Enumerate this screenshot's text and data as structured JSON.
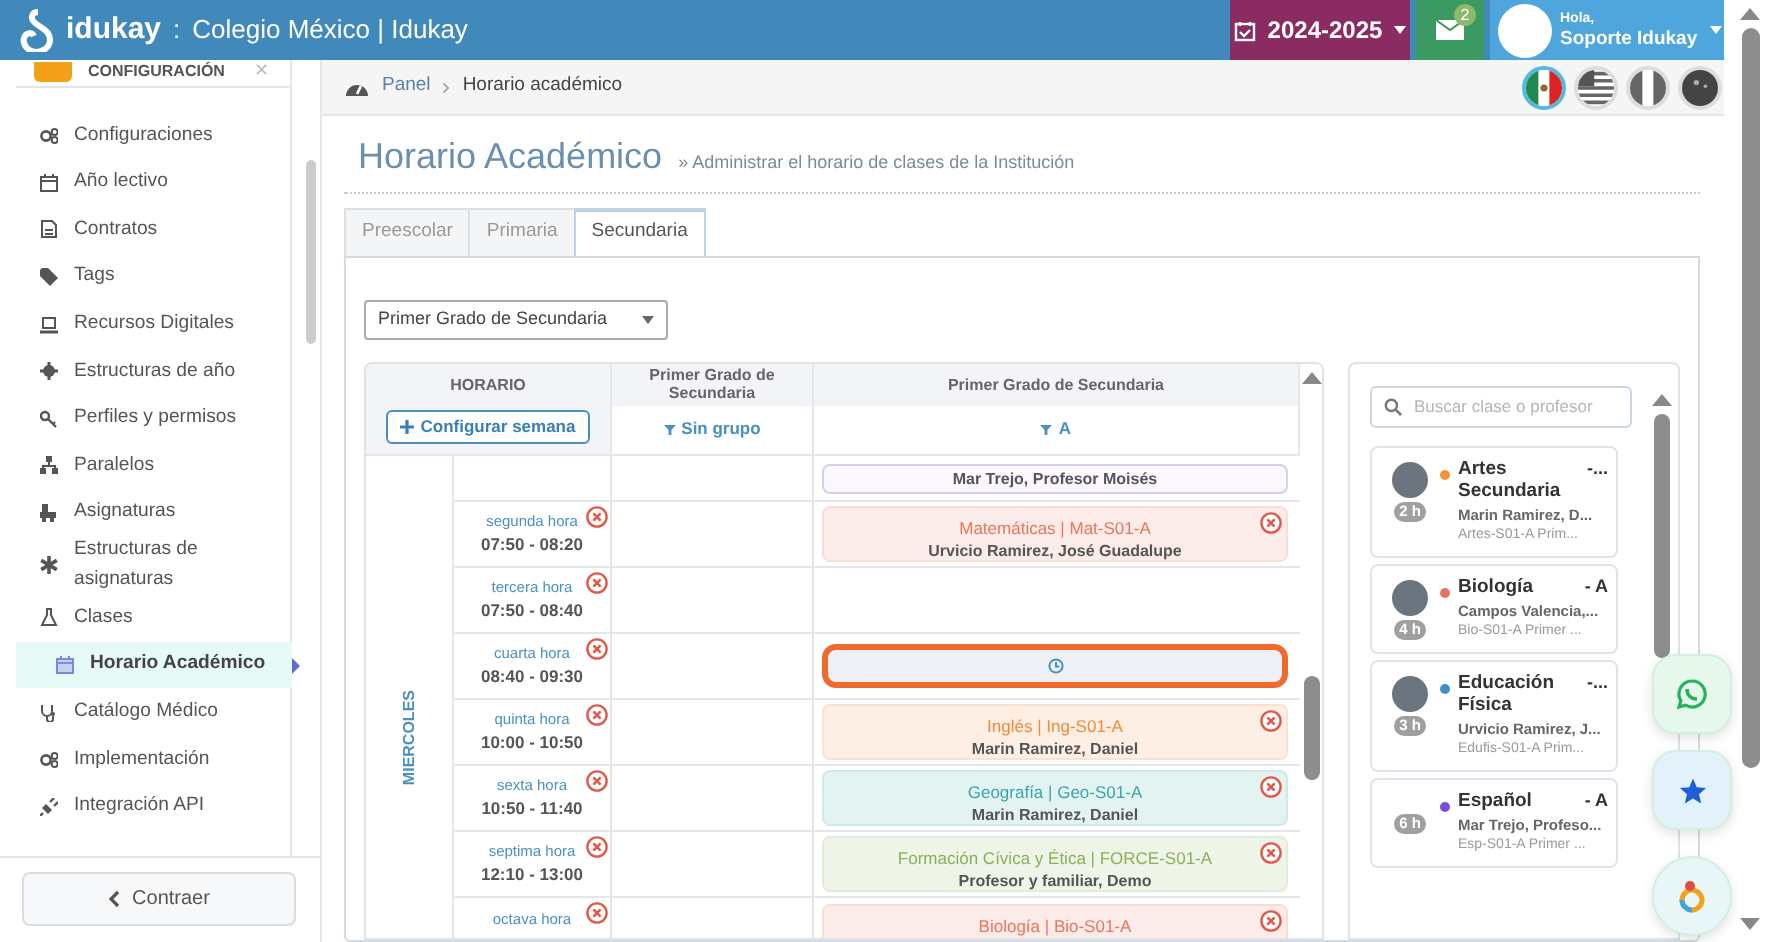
{
  "topbar": {
    "brand": "idukay",
    "separator": ":",
    "school": "Colegio México | Idukay",
    "year": "2024-2025",
    "mail_count": "2",
    "greeting": "Hola,",
    "user": "Soporte Idukay"
  },
  "languages": [
    {
      "kind": "mx",
      "selected": true
    },
    {
      "kind": "us",
      "selected": false
    },
    {
      "kind": "pe",
      "selected": false
    },
    {
      "kind": "dark",
      "selected": false
    }
  ],
  "sidebar": {
    "section": "CONFIGURACIÓN",
    "items": [
      {
        "label": "Configuraciones",
        "selected": false
      },
      {
        "label": "Año lectivo",
        "selected": false
      },
      {
        "label": "Contratos",
        "selected": false
      },
      {
        "label": "Tags",
        "selected": false
      },
      {
        "label": "Recursos Digitales",
        "selected": false
      },
      {
        "label": "Estructuras de año",
        "selected": false
      },
      {
        "label": "Perfiles y permisos",
        "selected": false
      },
      {
        "label": "Paralelos",
        "selected": false
      },
      {
        "label": "Asignaturas",
        "selected": false
      },
      {
        "label": "Estructuras de asignaturas",
        "selected": false
      },
      {
        "label": "Clases",
        "selected": false
      },
      {
        "label": "Horario Académico",
        "selected": true
      },
      {
        "label": "Catálogo Médico",
        "selected": false
      },
      {
        "label": "Implementación",
        "selected": false
      },
      {
        "label": "Integración API",
        "selected": false
      }
    ],
    "close": "✕",
    "collapse": "Contraer"
  },
  "breadcrumb": [
    "Panel",
    "Horario académico"
  ],
  "page": {
    "title": "Horario Académico",
    "subtitle": "» Administrar el horario de clases de la Institución"
  },
  "tabs": [
    {
      "label": "Preescolar",
      "selected": false
    },
    {
      "label": "Primaria",
      "selected": false
    },
    {
      "label": "Secundaria",
      "selected": true
    }
  ],
  "grade_select": {
    "value": "Primer Grado de Secundaria"
  },
  "schedule": {
    "corner_title": "HORARIO",
    "configure_button": "Configurar semana",
    "columns": [
      {
        "title": "Primer Grado de Secundaria",
        "filter": "Sin grupo"
      },
      {
        "title": "Primer Grado de Secundaria",
        "filter": "A"
      }
    ],
    "day": "MIERCOLES",
    "rows": [
      {
        "kind": "partial",
        "cells": [
          {
            "kind": "empty"
          },
          {
            "kind": "tail",
            "teacher": "Mar Trejo, Profesor Moisés",
            "color": "#d8cdef"
          }
        ]
      },
      {
        "kind": "period",
        "period": "segunda hora",
        "time": "07:50 - 08:20",
        "cells": [
          {
            "kind": "empty"
          },
          {
            "kind": "class",
            "subject": "Matemáticas | Mat-S01-A",
            "teacher": "Urvicio Ramirez, José Guadalupe",
            "color": "#e8765f"
          }
        ]
      },
      {
        "kind": "period",
        "period": "tercera hora",
        "time": "07:50 - 08:40",
        "cells": [
          {
            "kind": "empty"
          },
          {
            "kind": "empty"
          }
        ]
      },
      {
        "kind": "period",
        "period": "cuarta hora",
        "time": "08:40 - 09:30",
        "cells": [
          {
            "kind": "empty"
          },
          {
            "kind": "slot",
            "highlighted": true
          }
        ]
      },
      {
        "kind": "period",
        "period": "quinta hora",
        "time": "10:00 - 10:50",
        "cells": [
          {
            "kind": "empty"
          },
          {
            "kind": "class",
            "subject": "Inglés | Ing-S01-A",
            "teacher": "Marin Ramirez, Daniel",
            "color": "#f08a3c"
          }
        ]
      },
      {
        "kind": "period",
        "period": "sexta hora",
        "time": "10:50 - 11:40",
        "cells": [
          {
            "kind": "empty"
          },
          {
            "kind": "class",
            "subject": "Geografía | Geo-S01-A",
            "teacher": "Marin Ramirez, Daniel",
            "color": "#3aa7a4"
          }
        ]
      },
      {
        "kind": "period",
        "period": "septima hora",
        "time": "12:10 - 13:00",
        "cells": [
          {
            "kind": "empty"
          },
          {
            "kind": "class",
            "subject": "Formación Cívica y Ética | FORCE-S01-A",
            "teacher": "Profesor y familiar, Demo",
            "color": "#8cb05a"
          }
        ]
      },
      {
        "kind": "period",
        "period": "octava hora",
        "cells": [
          {
            "kind": "empty"
          },
          {
            "kind": "class",
            "subject": "Biología | Bio-S01-A",
            "color": "#e8765f"
          }
        ]
      }
    ]
  },
  "class_panel": {
    "search_placeholder": "Buscar clase o profesor",
    "classes": [
      {
        "name": "Artes Secundaria",
        "section": "-...",
        "teacher": "Marin Ramirez, D...",
        "code": "Artes-S01-A Prim...",
        "hours": "2 h",
        "color": "#f5923e",
        "avatar": true
      },
      {
        "name": "Biología",
        "section": "- A",
        "teacher": "Campos Valencia,...",
        "code": "Bio-S01-A Primer ...",
        "hours": "4 h",
        "color": "#e57368",
        "avatar": true
      },
      {
        "name": "Educación Física",
        "section": "-...",
        "teacher": "Urvicio Ramirez, J...",
        "code": "Edufis-S01-A Prim...",
        "hours": "3 h",
        "color": "#3d8fc6",
        "avatar": true
      },
      {
        "name": "Español",
        "section": "- A",
        "teacher": "Mar Trejo, Profeso...",
        "code": "Esp-S01-A Primer ...",
        "hours": "6 h",
        "color": "#7b4fcf",
        "avatar": false
      }
    ]
  }
}
